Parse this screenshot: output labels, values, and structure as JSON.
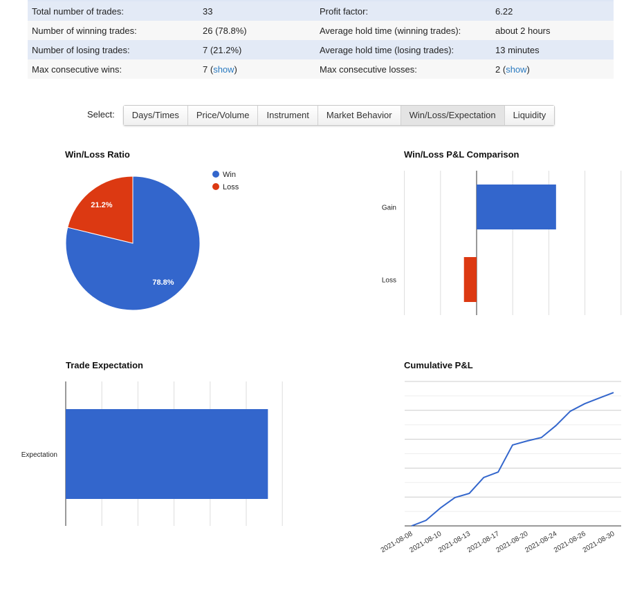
{
  "stats": [
    {
      "label": "Total number of trades:",
      "value": "33",
      "label2": "Profit factor:",
      "value2": "6.22"
    },
    {
      "label": "Number of winning trades:",
      "value": "26 (78.8%)",
      "label2": "Average hold time (winning trades):",
      "value2": "about 2 hours"
    },
    {
      "label": "Number of losing trades:",
      "value": "7 (21.2%)",
      "label2": "Average hold time (losing trades):",
      "value2": "13 minutes"
    },
    {
      "label": "Max consecutive wins:",
      "value": "7",
      "link": "show",
      "label2": "Max consecutive losses:",
      "value2": "2",
      "link2": "show"
    }
  ],
  "select": {
    "label": "Select:",
    "tabs": [
      "Days/Times",
      "Price/Volume",
      "Instrument",
      "Market Behavior",
      "Win/Loss/Expectation",
      "Liquidity"
    ],
    "active": 4
  },
  "colors": {
    "win": "#3366cc",
    "loss": "#dc3912"
  },
  "chart_data": [
    {
      "type": "pie",
      "title": "Win/Loss Ratio",
      "slices": [
        {
          "name": "Win",
          "value": 78.8,
          "label": "78.8%"
        },
        {
          "name": "Loss",
          "value": 21.2,
          "label": "21.2%"
        }
      ],
      "legend": "right"
    },
    {
      "type": "bar",
      "orientation": "horizontal",
      "title": "Win/Loss P&L Comparison",
      "categories": [
        "Gain",
        "Loss"
      ],
      "values": [
        2.2,
        -0.35
      ],
      "grid": true
    },
    {
      "type": "bar",
      "orientation": "horizontal",
      "title": "Trade Expectation",
      "categories": [
        "Expectation"
      ],
      "values": [
        5.6
      ],
      "grid": true
    },
    {
      "type": "line",
      "title": "Cumulative P&L",
      "x_tick_labels": [
        "2021-08-08",
        "2021-08-10",
        "2021-08-13",
        "2021-08-17",
        "2021-08-20",
        "2021-08-24",
        "2021-08-26",
        "2021-08-30"
      ],
      "values": [
        0,
        0.38,
        1.24,
        1.96,
        2.25,
        3.35,
        3.73,
        5.6,
        5.88,
        6.12,
        6.94,
        7.94,
        8.46,
        8.85,
        9.23
      ],
      "ylim": [
        0,
        10
      ],
      "grid": true
    }
  ]
}
